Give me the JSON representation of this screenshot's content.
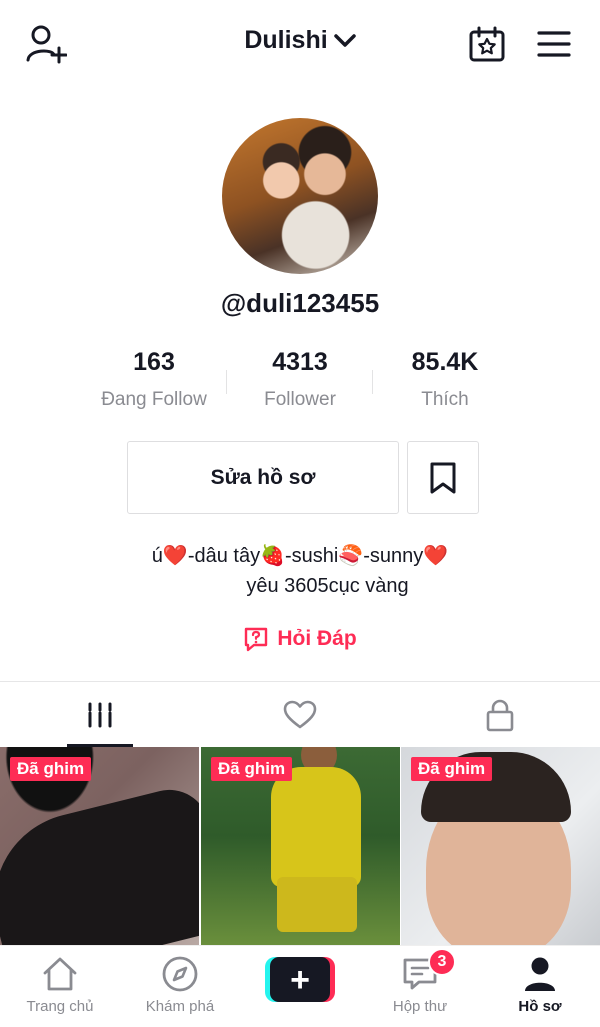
{
  "header": {
    "title": "Dulishi"
  },
  "profile": {
    "handle": "@duli123455",
    "stats": [
      {
        "value": "163",
        "label": "Đang Follow"
      },
      {
        "value": "4313",
        "label": "Follower"
      },
      {
        "value": "85.4K",
        "label": "Thích"
      }
    ],
    "edit_label": "Sửa hồ sơ",
    "bio_line1": "ú❤️-dâu tây🍓-sushi🍣-sunny❤️",
    "bio_line2": "yêu 3605cục vàng",
    "qa_label": "Hỏi Đáp"
  },
  "tabs": [
    "videos-grid-icon",
    "liked-heart-icon",
    "private-lock-icon"
  ],
  "videos": [
    {
      "pinned_label": "Đã ghim"
    },
    {
      "pinned_label": "Đã ghim"
    },
    {
      "pinned_label": "Đã ghim"
    }
  ],
  "bottom_nav": {
    "items": [
      {
        "label": "Trang chủ",
        "icon": "home-icon"
      },
      {
        "label": "Khám phá",
        "icon": "compass-icon"
      },
      {
        "label": "",
        "icon": "create-plus-icon"
      },
      {
        "label": "Hộp thư",
        "icon": "inbox-icon",
        "badge": "3"
      },
      {
        "label": "Hồ sơ",
        "icon": "profile-icon",
        "active": true
      }
    ]
  },
  "colors": {
    "accent": "#fe2c55",
    "cyan": "#25f4ee",
    "text": "#161823",
    "muted": "#8a8b91"
  }
}
